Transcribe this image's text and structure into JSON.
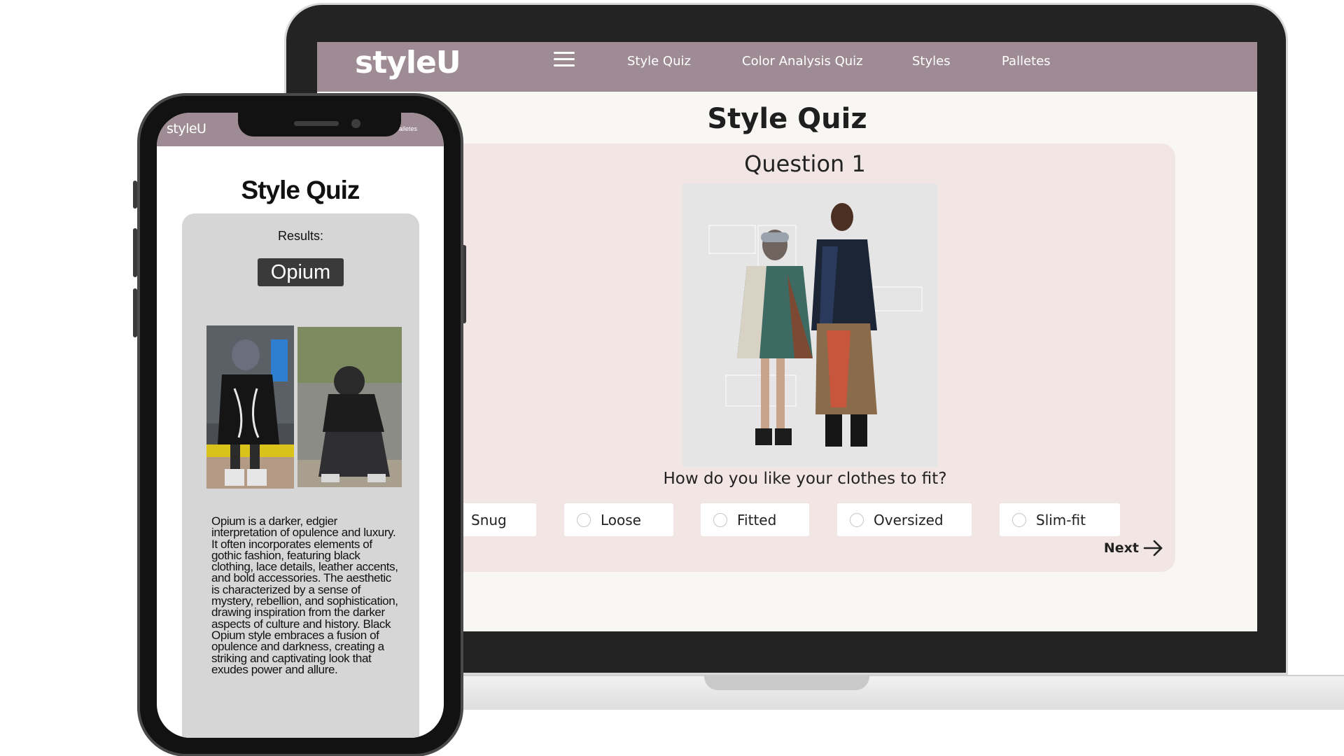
{
  "desktop": {
    "nav": {
      "logo": "styleU",
      "links": [
        "Style Quiz",
        "Color Analysis Quiz",
        "Styles",
        "Palletes"
      ]
    },
    "title": "Style Quiz",
    "question": {
      "heading": "Question 1",
      "text": "How do you like your clothes to fit?",
      "options": [
        "Snug",
        "Loose",
        "Fitted",
        "Oversized",
        "Slim-fit"
      ],
      "next_label": "Next"
    }
  },
  "phone": {
    "nav": {
      "logo": "styleU",
      "link": "Palletes"
    },
    "title": "Style Quiz",
    "results_label": "Results:",
    "result": "Opium",
    "description": "Opium is a darker, edgier interpretation of opulence and luxury. It often incorporates elements of gothic fashion, featuring black clothing, lace details, leather accents, and bold accessories. The aesthetic is characterized by a sense of mystery, rebellion, and sophistication, drawing inspiration from the darker aspects of culture and history. Black Opium style embraces a fusion of opulence and darkness, creating a striking and captivating look that exudes power and allure."
  },
  "colors": {
    "nav": "#9e8b94",
    "card": "#f2e6e4",
    "page": "#f9f7f4",
    "results_card": "#d6d6d6",
    "badge": "#3a3a3a"
  },
  "icons": [
    "hamburger-menu-icon",
    "back-arrow-icon",
    "next-arrow-icon"
  ]
}
